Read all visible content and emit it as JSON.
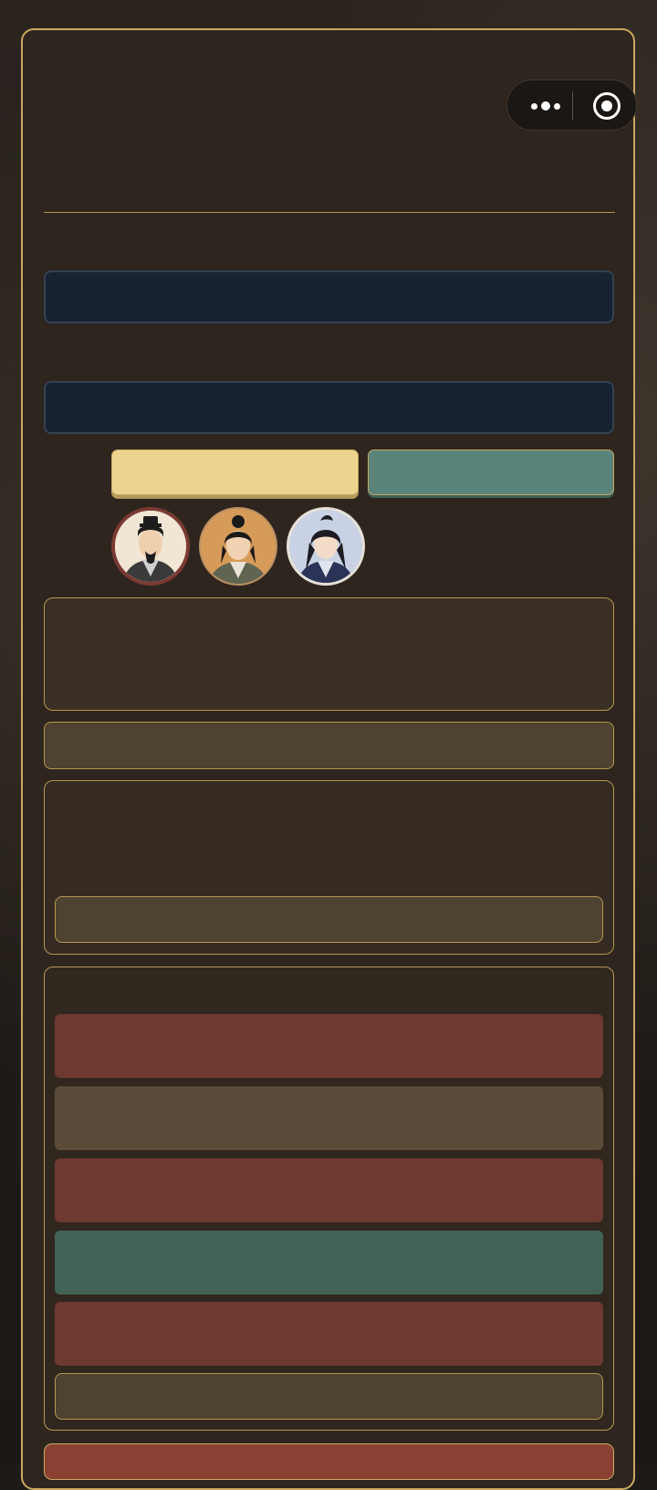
{
  "theme": {
    "gold": "#c9a861",
    "panel": "#2e251e",
    "navy": "#182331",
    "yellow_button": "#ecd38e",
    "teal_button": "#5a8479",
    "red_bar": "#6d3931",
    "brown_bar": "#5b4c39",
    "green_bar": "#416257",
    "bottom_button": "#8a4134"
  },
  "capsule": {
    "more_icon": "more-dots-icon",
    "close_icon": "target-circle-icon"
  },
  "avatars": [
    {
      "name": "avatar-1",
      "description_icon": "scholar-portrait",
      "ring": "#7a3a32",
      "bg": "#f1e5d4"
    },
    {
      "name": "avatar-2",
      "description_icon": "young-man-portrait",
      "ring": "#b99063",
      "bg": "#d79b59"
    },
    {
      "name": "avatar-3",
      "description_icon": "swordsman-portrait",
      "ring": "#e6e1d6",
      "bg": "#c8d2e4"
    }
  ]
}
